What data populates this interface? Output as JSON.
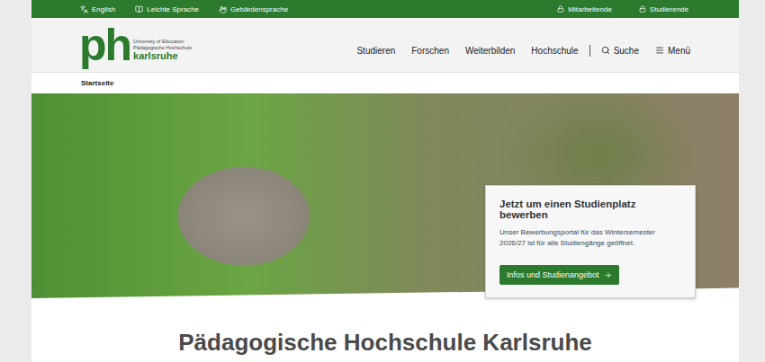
{
  "top_bar": {
    "left": [
      {
        "label": "English"
      },
      {
        "label": "Leichte Sprache"
      },
      {
        "label": "Gebärdensprache"
      }
    ],
    "right": [
      {
        "label": "Mitarbeitende"
      },
      {
        "label": "Studierende"
      }
    ]
  },
  "logo": {
    "mark": "ph",
    "lines": [
      "University of Education",
      "Pädagogische Hochschule"
    ],
    "name": "karlsruhe"
  },
  "nav": {
    "items": [
      "Studieren",
      "Forschen",
      "Weiterbilden",
      "Hochschule"
    ],
    "search": "Suche",
    "menu": "Menü"
  },
  "breadcrumb": [
    "Startseite"
  ],
  "hero": {
    "card": {
      "title": "Jetzt um einen Studienplatz bewerben",
      "text": "Unser Bewerbungsportal für das Wintersemester 2026/27 ist für alle Studiengänge geöffnet.",
      "button": "Infos und Studienangebot"
    }
  },
  "page_title": "Pädagogische Hochschule Karlsruhe"
}
